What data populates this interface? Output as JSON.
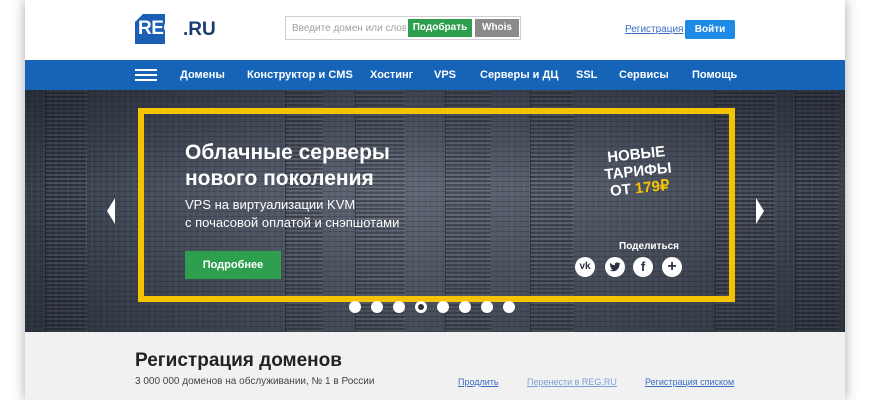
{
  "logo": {
    "reg": "REG",
    "ru": ".RU"
  },
  "search": {
    "placeholder": "Введите домен или слово",
    "find_label": "Подобрать",
    "whois_label": "Whois"
  },
  "header": {
    "register_label": "Регистрация",
    "login_label": "Войти"
  },
  "nav": {
    "items": [
      "Домены",
      "Конструктор и CMS",
      "Хостинг",
      "VPS",
      "Серверы и ДЦ",
      "SSL",
      "Сервисы",
      "Помощь"
    ]
  },
  "hero": {
    "title_line1": "Облачные серверы",
    "title_line2": "нового поколения",
    "sub_line1": "VPS на виртуализации KVM",
    "sub_line2": "с почасовой оплатой и снэпшотами",
    "button_label": "Подробнее",
    "promo_line1": "НОВЫЕ",
    "promo_line2": "ТАРИФЫ",
    "promo_prefix": "ОТ ",
    "promo_price": "179",
    "promo_currency": "₽",
    "share_label": "Поделиться",
    "social": [
      "vk-icon",
      "twitter-icon",
      "facebook-icon",
      "plus-icon"
    ],
    "slide_count": 8,
    "active_slide": 4
  },
  "domain_section": {
    "title": "Регистрация доменов",
    "subtitle": "3 000 000 доменов на обслуживании, № 1 в России",
    "links": [
      "Продлить",
      "Перенести в REG.RU",
      "Регистрация списком"
    ]
  },
  "colors": {
    "brand_blue": "#1564b8",
    "accent_yellow": "#f5c400",
    "button_green": "#2e9e4f",
    "login_blue": "#1e8ae6"
  }
}
